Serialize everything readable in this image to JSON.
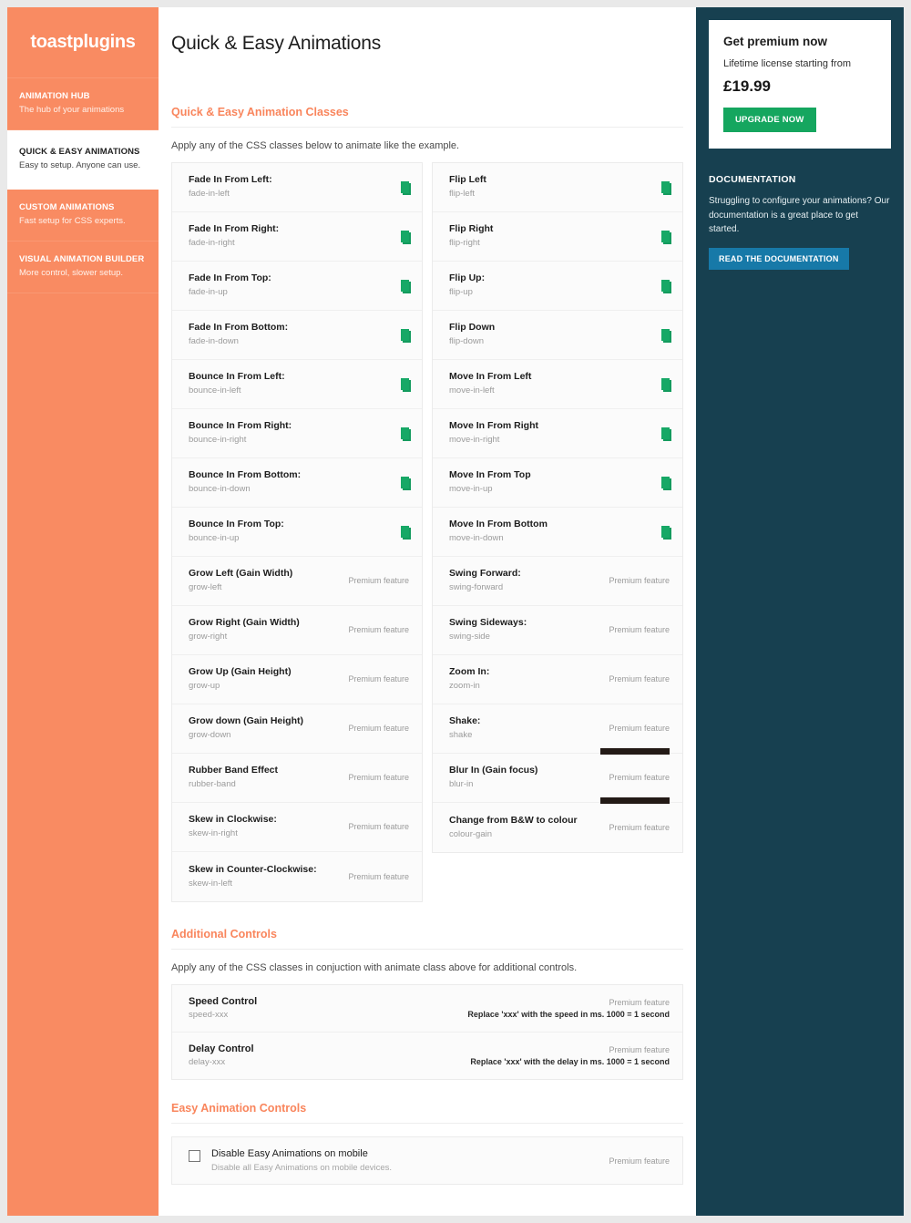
{
  "brand": {
    "name": "toastplugins"
  },
  "sidebar": {
    "items": [
      {
        "title": "ANIMATION HUB",
        "subtitle": "The hub of your animations",
        "active": false
      },
      {
        "title": "QUICK & EASY ANIMATIONS",
        "subtitle": "Easy to setup. Anyone can use.",
        "active": true
      },
      {
        "title": "CUSTOM ANIMATIONS",
        "subtitle": "Fast setup for CSS experts.",
        "active": false
      },
      {
        "title": "VISUAL ANIMATION BUILDER",
        "subtitle": "More control, slower setup.",
        "active": false
      }
    ]
  },
  "page": {
    "title": "Quick & Easy Animations"
  },
  "classes_section": {
    "heading": "Quick & Easy Animation Classes",
    "description": "Apply any of the CSS classes below to animate like the example.",
    "premium_label": "Premium feature",
    "left_column": [
      {
        "name": "Fade In From Left:",
        "css_class": "fade-in-left",
        "premium": false
      },
      {
        "name": "Fade In From Right:",
        "css_class": "fade-in-right",
        "premium": false
      },
      {
        "name": "Fade In From Top:",
        "css_class": "fade-in-up",
        "premium": false
      },
      {
        "name": "Fade In From Bottom:",
        "css_class": "fade-in-down",
        "premium": false
      },
      {
        "name": "Bounce In From Left:",
        "css_class": "bounce-in-left",
        "premium": false
      },
      {
        "name": "Bounce In From Right:",
        "css_class": "bounce-in-right",
        "premium": false
      },
      {
        "name": "Bounce In From Bottom:",
        "css_class": "bounce-in-down",
        "premium": false
      },
      {
        "name": "Bounce In From Top:",
        "css_class": "bounce-in-up",
        "premium": false
      },
      {
        "name": "Grow Left (Gain Width)",
        "css_class": "grow-left",
        "premium": true
      },
      {
        "name": "Grow Right (Gain Width)",
        "css_class": "grow-right",
        "premium": true
      },
      {
        "name": "Grow Up (Gain Height)",
        "css_class": "grow-up",
        "premium": true
      },
      {
        "name": "Grow down (Gain Height)",
        "css_class": "grow-down",
        "premium": true
      },
      {
        "name": "Rubber Band Effect",
        "css_class": "rubber-band",
        "premium": true
      },
      {
        "name": "Skew in Clockwise:",
        "css_class": "skew-in-right",
        "premium": true
      },
      {
        "name": "Skew in Counter-Clockwise:",
        "css_class": "skew-in-left",
        "premium": true
      }
    ],
    "right_column": [
      {
        "name": "Flip Left",
        "css_class": "flip-left",
        "premium": false
      },
      {
        "name": "Flip Right",
        "css_class": "flip-right",
        "premium": false
      },
      {
        "name": "Flip Up:",
        "css_class": "flip-up",
        "premium": false
      },
      {
        "name": "Flip Down",
        "css_class": "flip-down",
        "premium": false
      },
      {
        "name": "Move In From Left",
        "css_class": "move-in-left",
        "premium": false
      },
      {
        "name": "Move In From Right",
        "css_class": "move-in-right",
        "premium": false
      },
      {
        "name": "Move In From Top",
        "css_class": "move-in-up",
        "premium": false
      },
      {
        "name": "Move In From Bottom",
        "css_class": "move-in-down",
        "premium": false
      },
      {
        "name": "Swing Forward:",
        "css_class": "swing-forward",
        "premium": true
      },
      {
        "name": "Swing Sideways:",
        "css_class": "swing-side",
        "premium": true
      },
      {
        "name": "Zoom In:",
        "css_class": "zoom-in",
        "premium": true
      },
      {
        "name": "Shake:",
        "css_class": "shake",
        "premium": true,
        "bar": true
      },
      {
        "name": "Blur In (Gain focus)",
        "css_class": "blur-in",
        "premium": true,
        "bar": true
      },
      {
        "name": "Change from B&W to colour",
        "css_class": "colour-gain",
        "premium": true
      }
    ]
  },
  "additional_section": {
    "heading": "Additional Controls",
    "description": "Apply any of the CSS classes in conjuction with animate class above for additional controls.",
    "rows": [
      {
        "name": "Speed Control",
        "css_class": "speed-xxx",
        "premium_label": "Premium feature",
        "hint": "Replace 'xxx' with the speed in ms. 1000 = 1 second"
      },
      {
        "name": "Delay Control",
        "css_class": "delay-xxx",
        "premium_label": "Premium feature",
        "hint": "Replace 'xxx' with the delay in ms. 1000 = 1 second"
      }
    ]
  },
  "easy_controls_section": {
    "heading": "Easy Animation Controls",
    "toggle": {
      "label": "Disable Easy Animations on mobile",
      "sublabel": "Disable all Easy Animations on mobile devices.",
      "premium_label": "Premium feature",
      "checked": false
    }
  },
  "rightbar": {
    "premium": {
      "title": "Get premium now",
      "subtitle": "Lifetime license starting from",
      "price": "£19.99",
      "button": "UPGRADE NOW"
    },
    "documentation": {
      "title": "DOCUMENTATION",
      "body": "Struggling to configure your animations? Our documentation is a great place to get started.",
      "button": "READ THE DOCUMENTATION"
    }
  },
  "colors": {
    "brand_orange": "#f98b62",
    "heading_orange": "#f9855c",
    "dark_teal": "#174050",
    "green": "#15a65f",
    "blue": "#1779a8",
    "demo_green": "#17a866",
    "demo_dark": "#231a16"
  }
}
